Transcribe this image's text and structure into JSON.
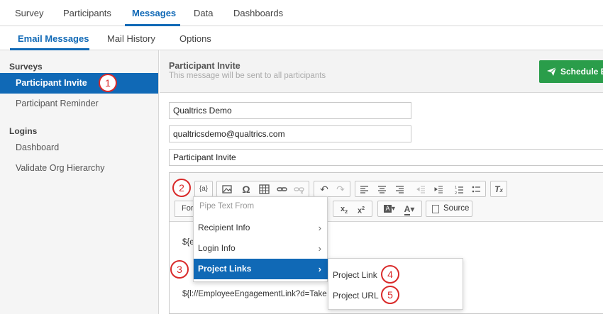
{
  "topnav": {
    "tabs": [
      {
        "label": "Survey"
      },
      {
        "label": "Participants"
      },
      {
        "label": "Messages"
      },
      {
        "label": "Data"
      },
      {
        "label": "Dashboards"
      }
    ],
    "active": "Messages"
  },
  "subnav": {
    "tabs": [
      {
        "label": "Email Messages"
      },
      {
        "label": "Mail History"
      },
      {
        "label": "Options"
      }
    ],
    "active": "Email Messages"
  },
  "sidebar": {
    "sections": [
      {
        "heading": "Surveys",
        "items": [
          {
            "label": "Participant Invite"
          },
          {
            "label": "Participant Reminder"
          }
        ]
      },
      {
        "heading": "Logins",
        "items": [
          {
            "label": "Dashboard"
          },
          {
            "label": "Validate Org Hierarchy"
          }
        ]
      }
    ]
  },
  "badges": [
    "1",
    "2",
    "3",
    "4",
    "5"
  ],
  "header": {
    "title": "Participant Invite",
    "subtitle": "This message will be sent to all participants",
    "schedule_label": "Schedule E"
  },
  "fields": {
    "from_name": "Qualtrics Demo",
    "from_email": "qualtricsdemo@qualtrics.com",
    "subject": "Participant Invite"
  },
  "toolbar": {
    "piped_text": "{a}",
    "format_label": "For",
    "source_label": "Source"
  },
  "body": {
    "line1": "${e",
    "line2": "${l://EmployeeEngagementLink?d=Take"
  },
  "pipe_menu": {
    "heading": "Pipe Text From",
    "items": [
      {
        "label": "Recipient Info"
      },
      {
        "label": "Login Info"
      },
      {
        "label": "Project Links"
      }
    ],
    "chevron": "›"
  },
  "project_links_menu": {
    "items": [
      {
        "label": "Project Link"
      },
      {
        "label": "Project URL"
      }
    ]
  },
  "colors": {
    "accent": "#1069b6",
    "success": "#2a9d4a",
    "badge": "#d92a2a"
  }
}
